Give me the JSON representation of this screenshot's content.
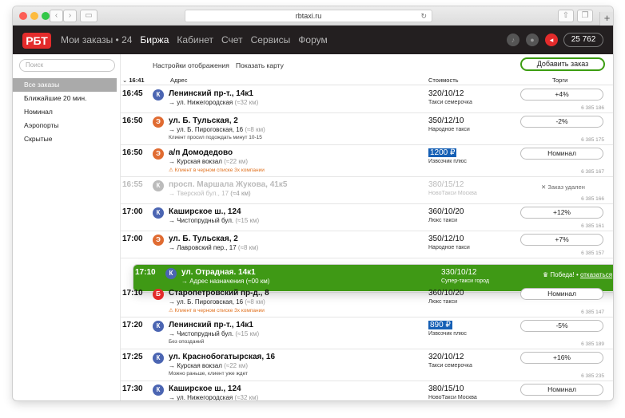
{
  "browser": {
    "url": "rbtaxi.ru"
  },
  "nav": {
    "logo": "РБТ",
    "links": [
      "Мои заказы • 24",
      "Биржа",
      "Кабинет",
      "Счет",
      "Сервисы",
      "Форум"
    ],
    "balance": "25 762"
  },
  "sidebar": {
    "search_placeholder": "Поиск",
    "items": [
      "Все заказы",
      "Ближайшие 20 мин.",
      "Номинал",
      "Аэропорты",
      "Скрытые"
    ]
  },
  "toolbar": {
    "display_settings": "Настройки отображения",
    "show_map": "Показать карту",
    "add_order": "Добавить заказ"
  },
  "table": {
    "time_header": "16:41",
    "address_header": "Адрес",
    "price_header": "Стоимость",
    "bid_header": "Торги"
  },
  "orders": [
    {
      "time": "16:45",
      "badge": "К",
      "color": "blue",
      "address": "Ленинский пр-т., 14к1",
      "dest": "→ ул. Нижегородская",
      "km": "(≈32 км)",
      "note": "",
      "price": "320/10/12",
      "service": "Такси семерочка",
      "bid": "+4%",
      "id": "6 385 186"
    },
    {
      "time": "16:50",
      "badge": "Э",
      "color": "orange",
      "address": "ул. Б. Тульская, 2",
      "dest": "→ ул. Б. Пироговская, 16",
      "km": "(≈8 км)",
      "note": "Клиент просил подождать минут 10-15",
      "price": "350/12/10",
      "service": "Народное такси",
      "bid": "-2%",
      "id": "6 385 175"
    },
    {
      "time": "16:50",
      "badge": "Э",
      "color": "orange",
      "address": "а/п Домодедово",
      "dest": "→ Курская вокзал",
      "km": "(≈22 км)",
      "note": "⚠ Клиент в черном списке 3х компании",
      "price": "1200 ₽",
      "service": "Извозчик плюс",
      "bid": "Номинал",
      "id": "6 385 167"
    },
    {
      "time": "16:55",
      "badge": "К",
      "color": "gray",
      "address": "просп. Маршала Жукова, 41к5",
      "dest": "→ Тверской бул., 17",
      "km": "(≈4 км)",
      "note": "",
      "price": "380/15/12",
      "service": "НовоТакси Москва",
      "bid": "",
      "removed": "✕ Заказ удален",
      "id": "6 385 166"
    },
    {
      "time": "17:00",
      "badge": "К",
      "color": "blue",
      "address": "Каширское ш., 124",
      "dest": "→ Чистопрудный бул.",
      "km": "(≈15 км)",
      "note": "",
      "price": "360/10/20",
      "service": "Люкс такси",
      "bid": "+12%",
      "id": "6 385 161"
    },
    {
      "time": "17:00",
      "badge": "Э",
      "color": "orange",
      "address": "ул. Б. Тульская, 2",
      "dest": "→ Лавровский пер., 17",
      "km": "(≈8 км)",
      "note": "",
      "price": "350/12/10",
      "service": "Народное такси",
      "bid": "+7%",
      "id": "6 385 157"
    },
    {
      "time": "17:10",
      "badge": "К",
      "color": "blue",
      "address": "ул. Отрадная. 14к1",
      "dest": "→ Адрес назначения",
      "km": "(≈00 км)",
      "note": "",
      "price": "330/10/12",
      "service": "Супер-такси город",
      "bid": "",
      "won": "Победа!",
      "refuse": "отказаться",
      "id": "6 385 155"
    },
    {
      "time": "17:10",
      "badge": "Б",
      "color": "red",
      "address": "Старопетровский пр-д., 8",
      "dest": "→ ул. Б. Пироговская, 16",
      "km": "(≈8 км)",
      "note": "⚠ Клиент в черном списке 3х компании",
      "price": "360/10/20",
      "service": "Люкс такси",
      "bid": "Номинал",
      "id": "6 385 147"
    },
    {
      "time": "17:20",
      "badge": "К",
      "color": "blue",
      "address": "Ленинский пр-т., 14к1",
      "dest": "→ Чистопрудный бул.",
      "km": "(≈15 км)",
      "note": "Без опозданий",
      "price": "890 ₽",
      "service": "Извозчик плюс",
      "bid": "-5%",
      "id": "6 385 189"
    },
    {
      "time": "17:25",
      "badge": "К",
      "color": "blue",
      "address": "ул. Краснобогатырская, 16",
      "dest": "→ Курская вокзал",
      "km": "(≈22 км)",
      "note": "Можно раньше, клиент уже ждет",
      "price": "320/10/12",
      "service": "Такси семерочка",
      "bid": "+16%",
      "id": "6 385 235"
    },
    {
      "time": "17:30",
      "badge": "К",
      "color": "blue",
      "address": "Каширское ш., 124",
      "dest": "→ ул. Нижегородская",
      "km": "(≈32 км)",
      "note": "",
      "price": "380/15/10",
      "service": "НовоТакси Москва",
      "bid": "Номинал",
      "id": "6 385 181"
    }
  ],
  "colors": {
    "accent": "#e32b2b",
    "win": "#3f9915",
    "highlight": "#1660b5",
    "nav_bg": "#231f20"
  }
}
